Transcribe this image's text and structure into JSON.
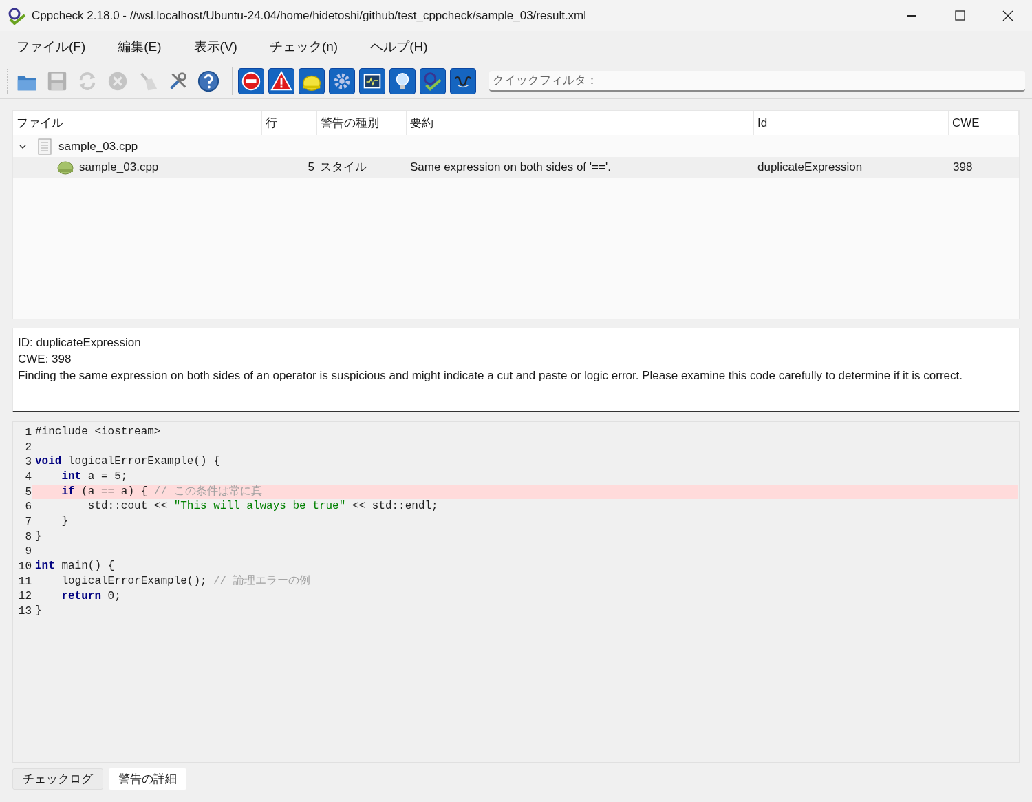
{
  "window": {
    "title": "Cppcheck 2.18.0 - //wsl.localhost/Ubuntu-24.04/home/hidetoshi/github/test_cppcheck/sample_03/result.xml"
  },
  "menu": [
    "ファイル(F)",
    "編集(E)",
    "表示(V)",
    "チェック(n)",
    "ヘルプ(H)"
  ],
  "toolbar": {
    "actions": [
      {
        "kind": "open",
        "disabled": false
      },
      {
        "kind": "save",
        "disabled": true
      },
      {
        "kind": "reload",
        "disabled": true
      },
      {
        "kind": "stop",
        "disabled": true
      },
      {
        "kind": "clear",
        "disabled": true
      },
      {
        "kind": "tools",
        "disabled": false
      },
      {
        "kind": "help",
        "disabled": false
      }
    ],
    "filters": [
      {
        "kind": "error",
        "checked": true
      },
      {
        "kind": "warning",
        "checked": true
      },
      {
        "kind": "style",
        "checked": true
      },
      {
        "kind": "performance",
        "checked": true
      },
      {
        "kind": "portability",
        "checked": true
      },
      {
        "kind": "information",
        "checked": true
      },
      {
        "kind": "cpp",
        "checked": true
      },
      {
        "kind": "misra",
        "checked": true
      }
    ],
    "quick_filter": {
      "placeholder": "クイックフィルタ："
    }
  },
  "results": {
    "columns": [
      "ファイル",
      "行",
      "警告の種別",
      "要約",
      "Id",
      "CWE"
    ],
    "files": [
      {
        "name": "sample_03.cpp",
        "expanded": true,
        "children": [
          {
            "file": "sample_03.cpp",
            "line": "5",
            "severity": "スタイル",
            "summary": "Same expression on both sides of '=='.",
            "id": "duplicateExpression",
            "cwe": "398",
            "selected": true
          }
        ]
      }
    ]
  },
  "details": [
    "ID: duplicateExpression",
    "CWE: 398",
    "Finding the same expression on both sides of an operator is suspicious and might indicate a cut and paste or logic error. Please examine this code carefully to determine if it is correct."
  ],
  "code": [
    {
      "number": "1",
      "highlighted": false,
      "tokens": [
        {
          "kind": "plain",
          "text": "#include <iostream>"
        }
      ]
    },
    {
      "number": "2",
      "highlighted": false
    },
    {
      "number": "3",
      "highlighted": false,
      "tokens": [
        {
          "kind": "keyword",
          "text": "void"
        },
        {
          "kind": "plain",
          "text": " logicalErrorExample() {"
        }
      ]
    },
    {
      "number": "4",
      "highlighted": false,
      "tokens": [
        {
          "kind": "keyword",
          "text": "    int"
        },
        {
          "kind": "plain",
          "text": " a = 5;"
        }
      ]
    },
    {
      "number": "5",
      "highlighted": true,
      "tokens": [
        {
          "kind": "keyword",
          "text": "    if"
        },
        {
          "kind": "plain",
          "text": " (a == a) { "
        },
        {
          "kind": "comment",
          "text": "// この条件は常に真"
        }
      ]
    },
    {
      "number": "6",
      "highlighted": false,
      "tokens": [
        {
          "kind": "plain",
          "text": "        std::cout << "
        },
        {
          "kind": "string",
          "text": "\"This will always be true\""
        },
        {
          "kind": "plain",
          "text": " << std::endl;"
        }
      ]
    },
    {
      "number": "7",
      "highlighted": false,
      "tokens": [
        {
          "kind": "plain",
          "text": "    }"
        }
      ]
    },
    {
      "number": "8",
      "highlighted": false,
      "tokens": [
        {
          "kind": "plain",
          "text": "}"
        }
      ]
    },
    {
      "number": "9",
      "highlighted": false
    },
    {
      "number": "10",
      "highlighted": false,
      "tokens": [
        {
          "kind": "keyword",
          "text": "int"
        },
        {
          "kind": "plain",
          "text": " main() {"
        }
      ]
    },
    {
      "number": "11",
      "highlighted": false,
      "tokens": [
        {
          "kind": "plain",
          "text": "    logicalErrorExample(); "
        },
        {
          "kind": "comment",
          "text": "// 論理エラーの例"
        }
      ]
    },
    {
      "number": "12",
      "highlighted": false,
      "tokens": [
        {
          "kind": "keyword",
          "text": "    return"
        },
        {
          "kind": "plain",
          "text": " 0;"
        }
      ]
    },
    {
      "number": "13",
      "highlighted": false,
      "tokens": [
        {
          "kind": "plain",
          "text": "}"
        }
      ]
    }
  ],
  "bottom_tabs": [
    {
      "label": "チェックログ",
      "selected": false
    },
    {
      "label": "警告の詳細",
      "selected": true
    }
  ]
}
